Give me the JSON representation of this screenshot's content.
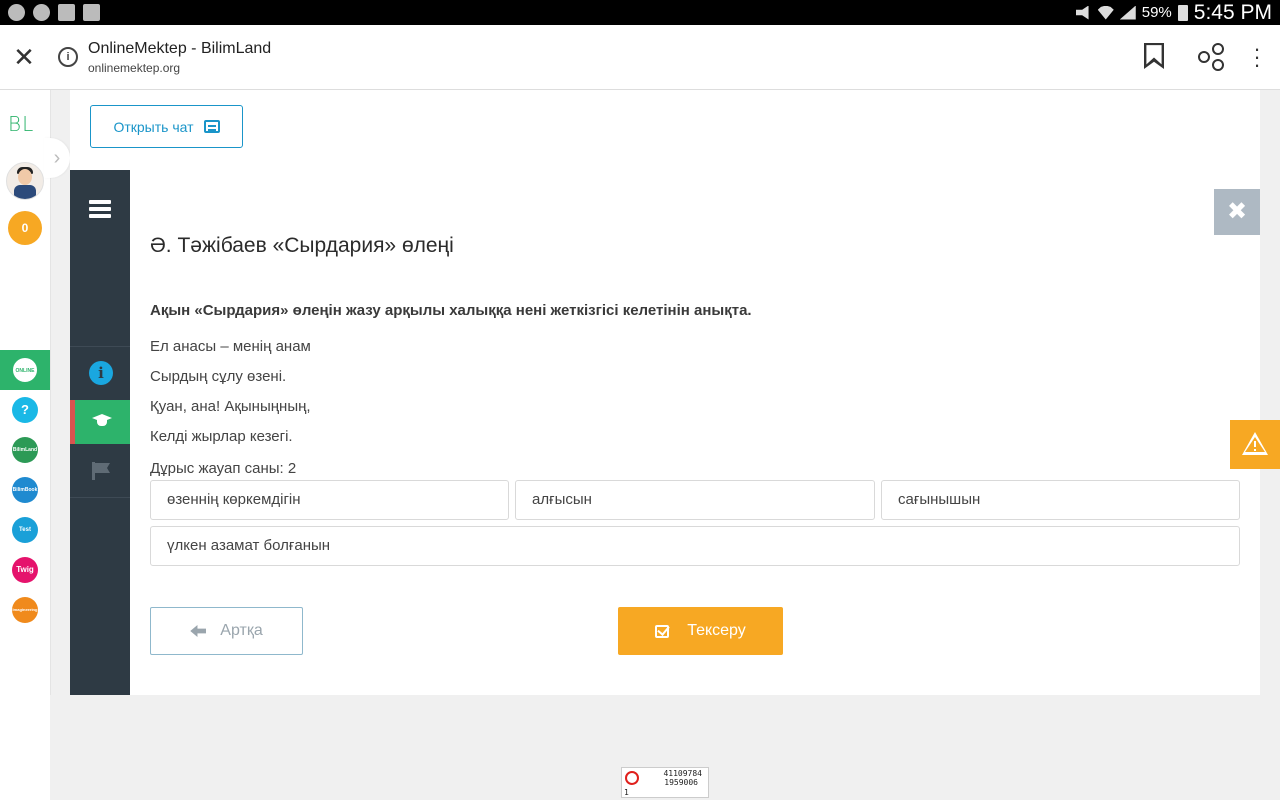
{
  "status_bar": {
    "battery": "59%",
    "time": "5:45 PM"
  },
  "browser": {
    "page_title": "OnlineMektep - BilimLand",
    "url": "onlinemektep.org",
    "close_icon": "close-icon",
    "info_icon": "info-icon",
    "bookmark_icon": "bookmark-icon",
    "share_icon": "share-icon",
    "more_icon": "more-vert-icon"
  },
  "sidebar": {
    "logo": "BL",
    "coins": "0",
    "apps": [
      {
        "label": "ONLINE MEKTEP",
        "color": "#2db36b",
        "active": true
      },
      {
        "label": "?",
        "color": "#1ab8e6"
      },
      {
        "label": "BilimLand",
        "color": "#2c9a56"
      },
      {
        "label": "BilimBook",
        "color": "#1f8ad0"
      },
      {
        "label": "Test",
        "color": "#1aa0d8"
      },
      {
        "label": "Twig",
        "color": "#e5136c"
      },
      {
        "label": "Imagineering",
        "color": "#f08a1c"
      }
    ]
  },
  "chat": {
    "label": "Открыть чат"
  },
  "lesson": {
    "title": "Ә. Тәжібаев «Сырдария» өлеңі",
    "question": "Ақын «Сырдария» өлеңін жазу арқылы халыққа нені жеткізгісі келетінін анықта.",
    "poem_lines": [
      "Ел анасы – менің анам",
      "Сырдың сұлу өзені.",
      "Қуан, ана! Ақыныңның,",
      "Келді жырлар кезегі."
    ],
    "answers_count": "Дұрыс жауап саны: 2",
    "options": [
      "өзеннің көркемдігін",
      "алғысын",
      "сағынышын",
      "үлкен азамат болғанын"
    ]
  },
  "buttons": {
    "back": "Артқа",
    "check": "Тексеру"
  },
  "counter": {
    "line1": "41109784",
    "line2": "1959006",
    "line3": "1"
  },
  "colors": {
    "accent_orange": "#f7a823",
    "accent_green": "#2db36b",
    "accent_blue": "#1a95c9",
    "nav_dark": "#2e3a44"
  }
}
